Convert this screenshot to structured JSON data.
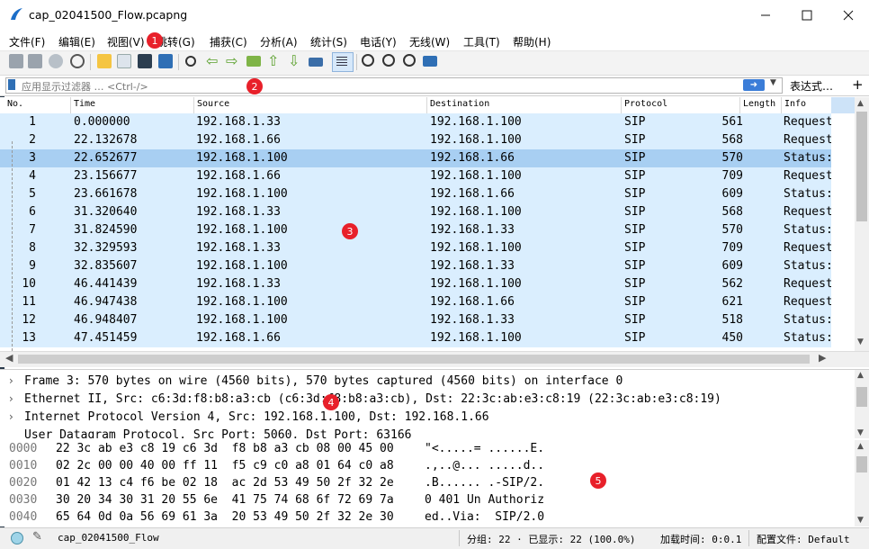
{
  "window": {
    "title": "cap_02041500_Flow.pcapng"
  },
  "menu": [
    "文件(F)",
    "编辑(E)",
    "视图(V)",
    "跳转(G)",
    "捕获(C)",
    "分析(A)",
    "统计(S)",
    "电话(Y)",
    "无线(W)",
    "工具(T)",
    "帮助(H)"
  ],
  "filter": {
    "placeholder": "应用显示过滤器 … <Ctrl-/>",
    "expression_label": "表达式…",
    "add_label": "+"
  },
  "columns": [
    "No.",
    "Time",
    "Source",
    "Destination",
    "Protocol",
    "Length",
    "Info"
  ],
  "packets": [
    {
      "no": "1",
      "time": "0.000000",
      "src": "192.168.1.33",
      "dst": "192.168.1.100",
      "proto": "SIP",
      "len": "561",
      "info": "Request"
    },
    {
      "no": "2",
      "time": "22.132678",
      "src": "192.168.1.66",
      "dst": "192.168.1.100",
      "proto": "SIP",
      "len": "568",
      "info": "Request"
    },
    {
      "no": "3",
      "time": "22.652677",
      "src": "192.168.1.100",
      "dst": "192.168.1.66",
      "proto": "SIP",
      "len": "570",
      "info": "Status:"
    },
    {
      "no": "4",
      "time": "23.156677",
      "src": "192.168.1.66",
      "dst": "192.168.1.100",
      "proto": "SIP",
      "len": "709",
      "info": "Request"
    },
    {
      "no": "5",
      "time": "23.661678",
      "src": "192.168.1.100",
      "dst": "192.168.1.66",
      "proto": "SIP",
      "len": "609",
      "info": "Status:"
    },
    {
      "no": "6",
      "time": "31.320640",
      "src": "192.168.1.33",
      "dst": "192.168.1.100",
      "proto": "SIP",
      "len": "568",
      "info": "Request"
    },
    {
      "no": "7",
      "time": "31.824590",
      "src": "192.168.1.100",
      "dst": "192.168.1.33",
      "proto": "SIP",
      "len": "570",
      "info": "Status:"
    },
    {
      "no": "8",
      "time": "32.329593",
      "src": "192.168.1.33",
      "dst": "192.168.1.100",
      "proto": "SIP",
      "len": "709",
      "info": "Request"
    },
    {
      "no": "9",
      "time": "32.835607",
      "src": "192.168.1.100",
      "dst": "192.168.1.33",
      "proto": "SIP",
      "len": "609",
      "info": "Status:"
    },
    {
      "no": "10",
      "time": "46.441439",
      "src": "192.168.1.33",
      "dst": "192.168.1.100",
      "proto": "SIP",
      "len": "562",
      "info": "Request"
    },
    {
      "no": "11",
      "time": "46.947438",
      "src": "192.168.1.100",
      "dst": "192.168.1.66",
      "proto": "SIP",
      "len": "621",
      "info": "Request"
    },
    {
      "no": "12",
      "time": "46.948407",
      "src": "192.168.1.100",
      "dst": "192.168.1.33",
      "proto": "SIP",
      "len": "518",
      "info": "Status:"
    },
    {
      "no": "13",
      "time": "47.451459",
      "src": "192.168.1.66",
      "dst": "192.168.1.100",
      "proto": "SIP",
      "len": "450",
      "info": "Status:"
    }
  ],
  "details": [
    "Frame 3: 570 bytes on wire (4560 bits), 570 bytes captured (4560 bits) on interface 0",
    "Ethernet II, Src: c6:3d:f8:b8:a3:cb (c6:3d:f8:b8:a3:cb), Dst: 22:3c:ab:e3:c8:19 (22:3c:ab:e3:c8:19)",
    "Internet Protocol Version 4, Src: 192.168.1.100, Dst: 192.168.1.66",
    "User Datagram Protocol, Src Port: 5060, Dst Port: 63166"
  ],
  "bytes": [
    {
      "offset": "0000",
      "hex": "22 3c ab e3 c8 19 c6 3d  f8 b8 a3 cb 08 00 45 00",
      "ascii": "\"<.....= ......E."
    },
    {
      "offset": "0010",
      "hex": "02 2c 00 00 40 00 ff 11  f5 c9 c0 a8 01 64 c0 a8",
      "ascii": ".,..@... .....d.."
    },
    {
      "offset": "0020",
      "hex": "01 42 13 c4 f6 be 02 18  ac 2d 53 49 50 2f 32 2e",
      "ascii": ".B...... .-SIP/2."
    },
    {
      "offset": "0030",
      "hex": "30 20 34 30 31 20 55 6e  41 75 74 68 6f 72 69 7a",
      "ascii": "0 401 Un Authoriz"
    },
    {
      "offset": "0040",
      "hex": "65 64 0d 0a 56 69 61 3a  20 53 49 50 2f 32 2e 30",
      "ascii": "ed..Via:  SIP/2.0"
    }
  ],
  "status": {
    "file": "cap_02041500_Flow",
    "packets": "分组: 22 · 已显示: 22 (100.0%)",
    "load": "加载时间: 0:0.1",
    "profile": "配置文件: Default"
  },
  "badges": [
    "1",
    "2",
    "3",
    "4",
    "5"
  ],
  "colors": {
    "row": "#daeefe",
    "selected": "#a8cff2",
    "accent": "#1c6ec8",
    "badge": "#e8202a"
  }
}
